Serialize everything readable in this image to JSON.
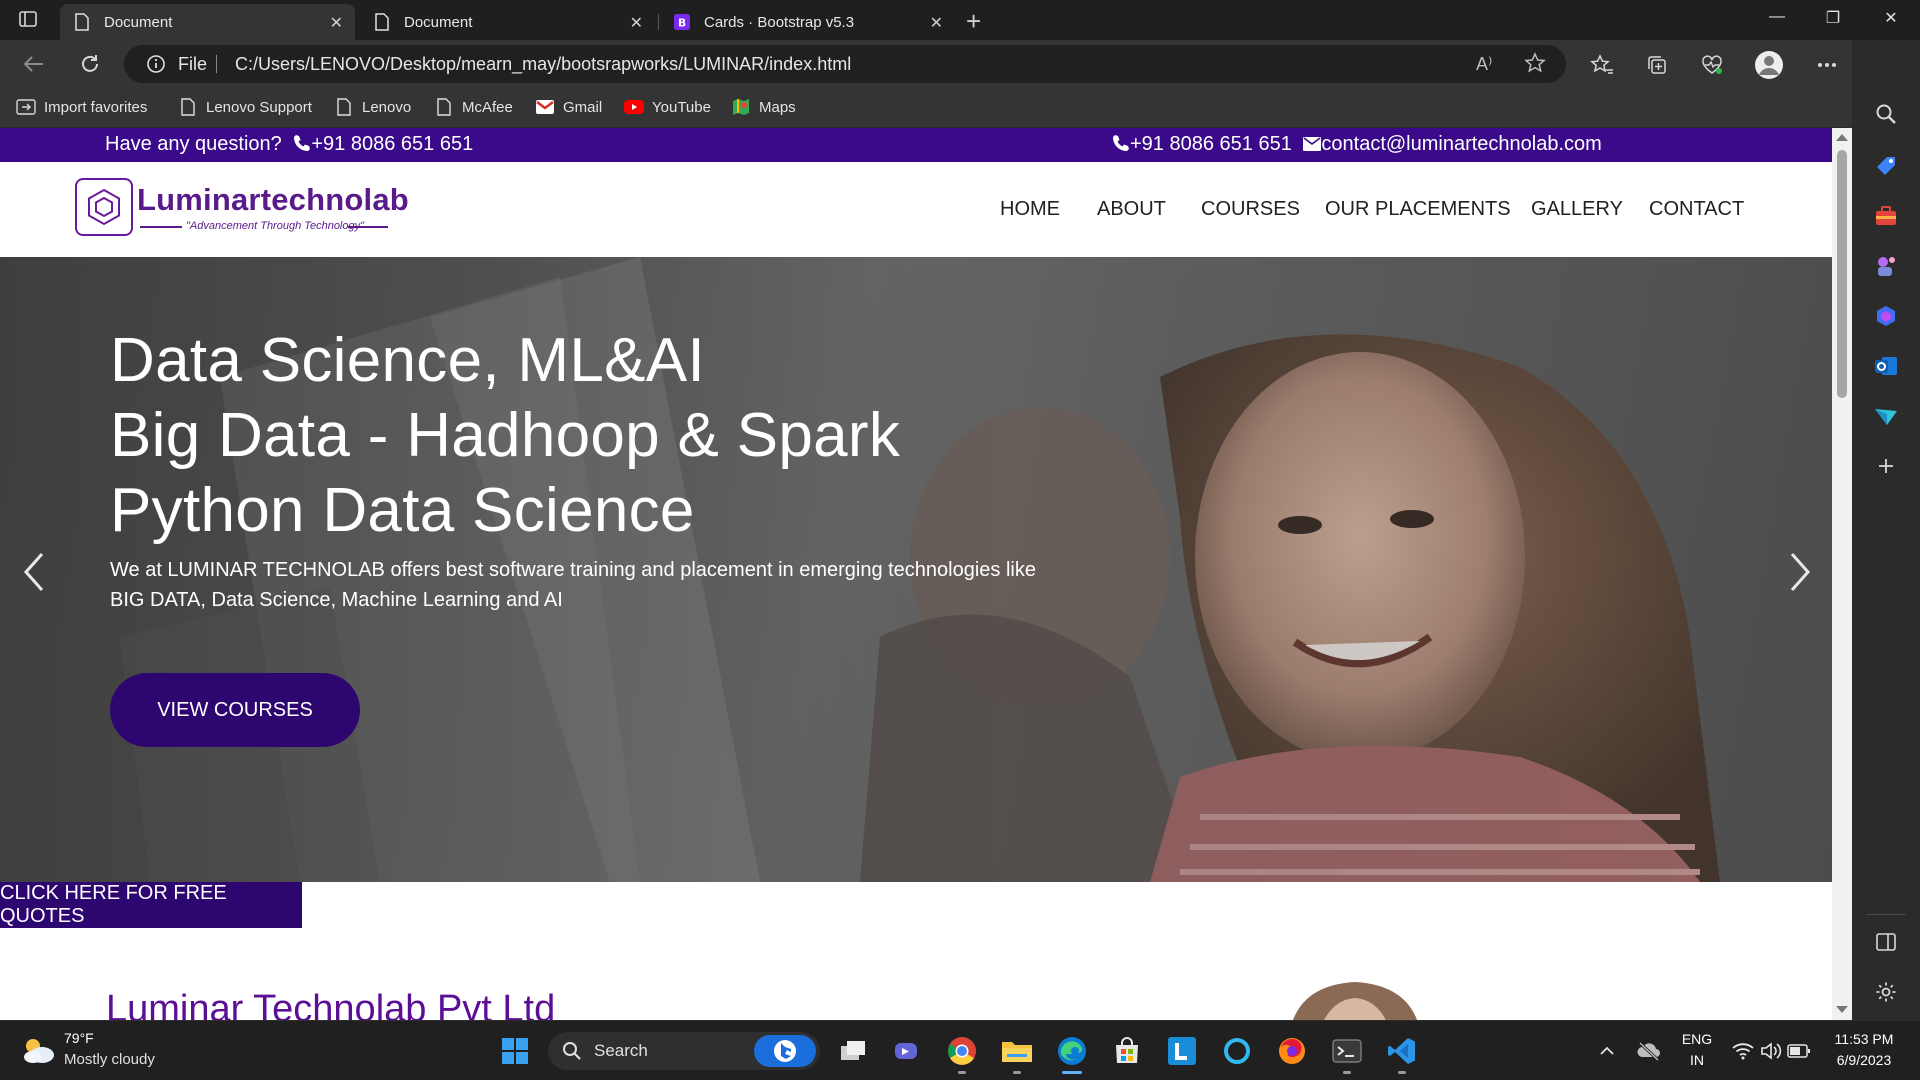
{
  "browser": {
    "tabs": [
      {
        "title": "Document",
        "icon": "document-icon",
        "active": true
      },
      {
        "title": "Document",
        "icon": "document-icon",
        "active": false
      },
      {
        "title": "Cards · Bootstrap v5.3",
        "icon": "bootstrap-icon",
        "active": false
      }
    ],
    "address": {
      "scheme_label": "File",
      "url": "C:/Users/LENOVO/Desktop/mearn_may/bootsrapworks/LUMINAR/index.html"
    },
    "favorites": [
      {
        "label": "Import favorites",
        "icon": "import-icon"
      },
      {
        "label": "Lenovo Support",
        "icon": "document-icon"
      },
      {
        "label": "Lenovo",
        "icon": "document-icon"
      },
      {
        "label": "McAfee",
        "icon": "document-icon"
      },
      {
        "label": "Gmail",
        "icon": "gmail-icon"
      },
      {
        "label": "YouTube",
        "icon": "youtube-icon"
      },
      {
        "label": "Maps",
        "icon": "maps-icon"
      }
    ],
    "read_aloud_icon": "A⁾"
  },
  "page": {
    "topbar": {
      "question": "Have any question?",
      "phone_left": "+91 8086 651 651",
      "phone_right": "+91 8086 651 651",
      "email": "contact@luminartechnolab.com"
    },
    "brand": {
      "name": "Luminartechnolab",
      "tagline": "\"Advancement Through Technology\""
    },
    "nav": [
      "HOME",
      "ABOUT",
      "COURSES",
      "OUR PLACEMENTS",
      "GALLERY",
      "CONTACT"
    ],
    "hero": {
      "line1": "Data Science, ML&AI",
      "line2": "Big Data - Hadhoop & Spark",
      "line3": "Python Data Science",
      "description": "We at LUMINAR TECHNOLAB offers best software training and placement in emerging technologies like BIG DATA, Data Science, Machine Learning and AI",
      "button": "VIEW COURSES"
    },
    "quote_button": "CLICK HERE FOR FREE QUOTES",
    "company_title": "Luminar Technolab Pvt Ltd"
  },
  "taskbar": {
    "weather": {
      "temp": "79°F",
      "desc": "Mostly cloudy"
    },
    "search_label": "Search",
    "lang": {
      "line1": "ENG",
      "line2": "IN"
    },
    "clock": {
      "time": "11:53 PM",
      "date": "6/9/2023"
    }
  },
  "colors": {
    "brand_purple": "#3a0a8a",
    "button_purple": "#2d0670",
    "title_purple": "#5a0f95",
    "accent_blue": "#0a84ff"
  }
}
